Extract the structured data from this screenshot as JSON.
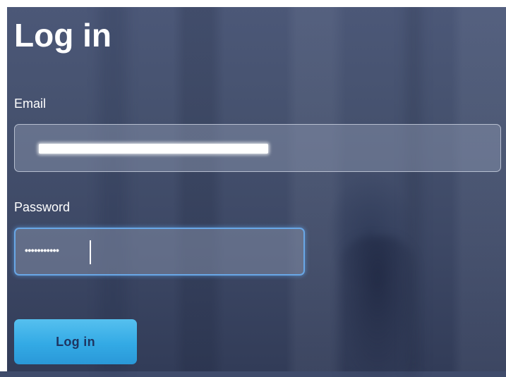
{
  "page": {
    "title": "Log in"
  },
  "form": {
    "email": {
      "label": "Email",
      "value_redacted": true
    },
    "password": {
      "label": "Password",
      "masked_value": "•••••••••••",
      "focused": true
    },
    "submit_label": "Log in"
  },
  "colors": {
    "button": "#33aae5",
    "button_text": "#1f3561",
    "focus_ring": "#69a7e6",
    "background": "#3f4b6b"
  }
}
